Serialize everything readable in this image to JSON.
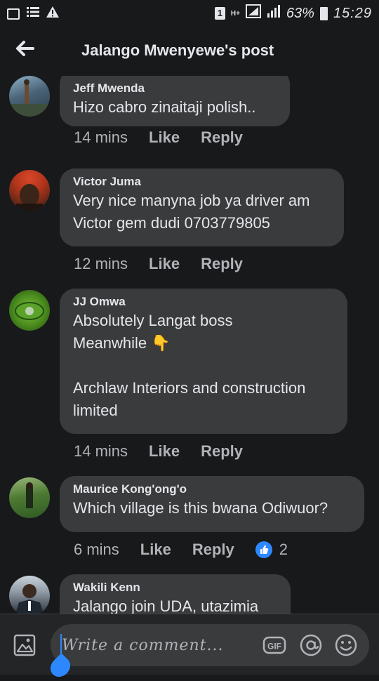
{
  "status_bar": {
    "sim_slot": "1",
    "network": "H+",
    "battery_percent": "63%",
    "time": "15:29"
  },
  "header": {
    "title": "Jalango Mwenyewe's post",
    "back_icon": "arrow-left-icon"
  },
  "actions": {
    "like": "Like",
    "reply": "Reply"
  },
  "comments": [
    {
      "author": "Jeff Mwenda",
      "text": "Hizo cabro zinaitaji polish..",
      "time": "14 mins",
      "avatar_colors": [
        "#2b3a4a",
        "#8fb1c9"
      ]
    },
    {
      "author": "Victor Juma",
      "text": "Very nice manyna job ya driver am\nVictor gem dudi 0703779805",
      "time": "12 mins",
      "avatar_colors": [
        "#c23b1e",
        "#3a2b1e"
      ]
    },
    {
      "author": "JJ Omwa",
      "text": "Absolutely Langat boss\nMeanwhile 👇\n\nArchlaw Interiors and construction\nlimited",
      "time": "14 mins",
      "avatar_colors": [
        "#5a9e2a",
        "#1f4a12"
      ]
    },
    {
      "author": "Maurice Kong'ong'o",
      "text": "Which village is this bwana Odiwuor?",
      "time": "6 mins",
      "reaction_count": "2",
      "avatar_colors": [
        "#2e5a22",
        "#9ab87a"
      ]
    },
    {
      "author": "Wakili Kenn",
      "text": "Jalango join UDA, utazimia",
      "time": "",
      "avatar_colors": [
        "#1e2630",
        "#c9d2da"
      ]
    }
  ],
  "composer": {
    "placeholder": "Write a comment...",
    "gif_label": "GIF",
    "icons": [
      "photo-icon",
      "gif-icon",
      "at-icon",
      "emoji-icon"
    ]
  },
  "colors": {
    "background": "#18191a",
    "bubble": "#3a3b3c",
    "accent": "#2d88ff",
    "text": "#e4e6eb",
    "secondary_text": "#b0b3b8"
  }
}
